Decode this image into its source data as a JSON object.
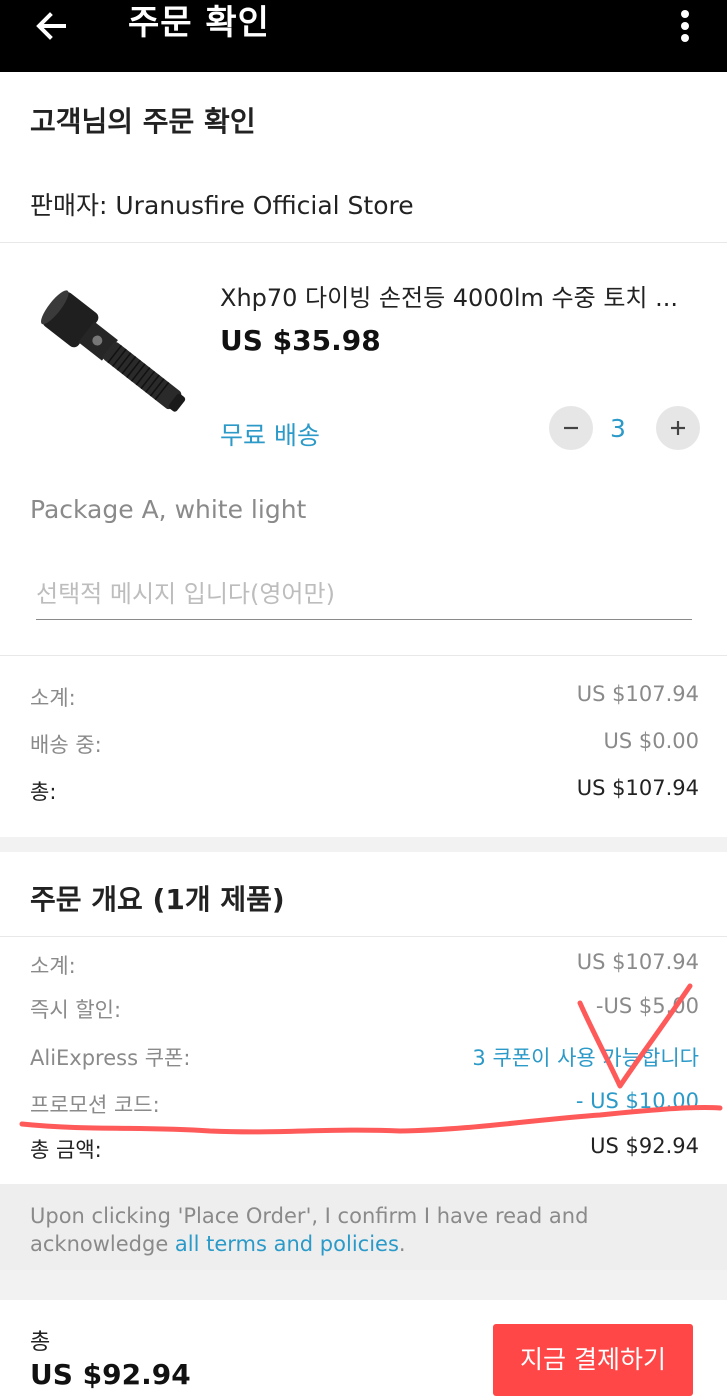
{
  "appbar": {
    "title": "주문 확인"
  },
  "order": {
    "heading": "고객님의 주문 확인",
    "seller_label": "판매자: Uranusfire Official Store"
  },
  "product": {
    "title": "Xhp70 다이빙 손전등 4000lm 수중 토치 ...",
    "price": "US $35.98",
    "shipping": "무료 배송",
    "quantity": "3",
    "variant": "Package A, white light",
    "message_placeholder": "선택적 메시지 입니다(영어만)"
  },
  "store_summary": {
    "rows": [
      {
        "label": "소계:",
        "value": "US $107.94"
      },
      {
        "label": "배송 중:",
        "value": "US $0.00"
      },
      {
        "label": "총:",
        "value": "US $107.94"
      }
    ]
  },
  "order_summary": {
    "heading": "주문 개요 (1개 제품)",
    "rows": [
      {
        "label": "소계:",
        "value": "US $107.94"
      },
      {
        "label": "즉시 할인:",
        "value": "-US $5.00"
      },
      {
        "label": "AliExpress 쿠폰:",
        "value": "3 쿠폰이 사용 가능합니다"
      },
      {
        "label": "프로모션 코드:",
        "value": "- US $10.00"
      },
      {
        "label": "총 금액:",
        "value": "US $92.94"
      }
    ]
  },
  "notice": {
    "text": "Upon clicking 'Place Order', I confirm I have read and acknowledge ",
    "link": "all terms and policies",
    "end": "."
  },
  "footer": {
    "total_label": "총",
    "total_value": "US $92.94",
    "pay_button": "지금 결제하기"
  },
  "colors": {
    "accent_blue": "#2b9ac8",
    "pay_red": "#ff4747",
    "annotation_red": "#ff5a5a",
    "appbar_bg": "#000000"
  },
  "icons": [
    "back-arrow-icon",
    "more-vertical-icon",
    "minus-icon",
    "plus-icon"
  ]
}
